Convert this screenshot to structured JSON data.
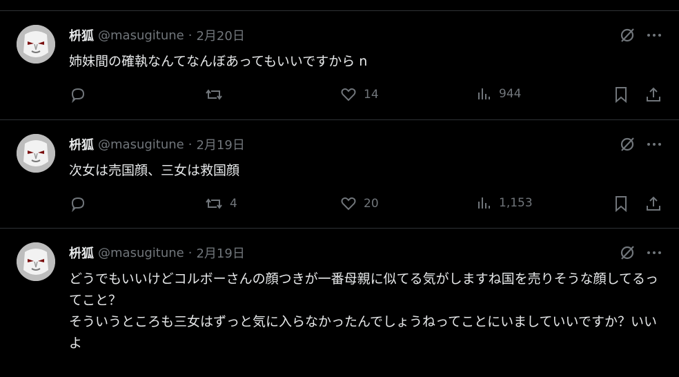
{
  "tweets": [
    {
      "name": "枡狐",
      "handle": "@masugitune",
      "separator": "·",
      "date": "2月20日",
      "text": "姉妹間の確執なんてなんぼあってもいいですから n",
      "replies": "",
      "retweets": "",
      "likes": "14",
      "views": "944"
    },
    {
      "name": "枡狐",
      "handle": "@masugitune",
      "separator": "·",
      "date": "2月19日",
      "text": "次女は売国顔、三女は救国顔",
      "replies": "",
      "retweets": "4",
      "likes": "20",
      "views": "1,153"
    },
    {
      "name": "枡狐",
      "handle": "@masugitune",
      "separator": "·",
      "date": "2月19日",
      "text": "どうでもいいけどコルボーさんの顔つきが一番母親に似てる気がしますね国を売りそうな顔してるってこと？\nそういうところも三女はずっと気に入らなかったんでしょうねってことにいましていいですか？いいよ"
    }
  ],
  "icons": {
    "grok": "grok-icon",
    "more": "more-icon",
    "reply": "reply-icon",
    "retweet": "retweet-icon",
    "like": "heart-icon",
    "views": "views-icon",
    "bookmark": "bookmark-icon",
    "share": "share-icon"
  },
  "colors": {
    "background": "#000000",
    "text": "#e7e9ea",
    "muted": "#71767b",
    "border": "#2f3336"
  }
}
